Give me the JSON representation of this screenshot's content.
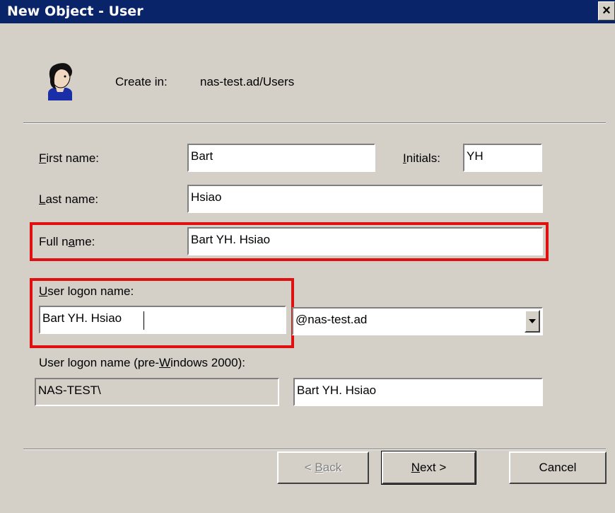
{
  "window": {
    "title": "New Object - User",
    "close_label": "×"
  },
  "header": {
    "create_in_label": "Create in:",
    "create_in_value": "nas-test.ad/Users"
  },
  "form": {
    "first_name": {
      "label_accel": "F",
      "label_rest": "irst name:",
      "value": "Bart"
    },
    "initials": {
      "label_accel": "I",
      "label_rest": "nitials:",
      "value": "YH"
    },
    "last_name": {
      "label_accel": "L",
      "label_rest": "ast name:",
      "value": "Hsiao"
    },
    "full_name": {
      "label_pre": "Full n",
      "label_accel": "a",
      "label_rest": "me:",
      "value": "Bart YH. Hsiao"
    },
    "logon_name": {
      "label_accel": "U",
      "label_rest": "ser logon name:",
      "value": "Bart YH. Hsiao",
      "domain_selected": "@nas-test.ad"
    },
    "pre2000": {
      "label_pre": "User logon name (pre-",
      "label_accel": "W",
      "label_rest": "indows 2000):",
      "domain_value": "NAS-TEST\\",
      "value": "Bart YH. Hsiao"
    }
  },
  "buttons": {
    "back": {
      "pre": "< ",
      "accel": "B",
      "rest": "ack"
    },
    "next": {
      "accel": "N",
      "rest": "ext >"
    },
    "cancel": "Cancel"
  },
  "colors": {
    "titlebar": "#0a246a",
    "highlight": "#e01010",
    "dialog": "#d4d0c8"
  }
}
